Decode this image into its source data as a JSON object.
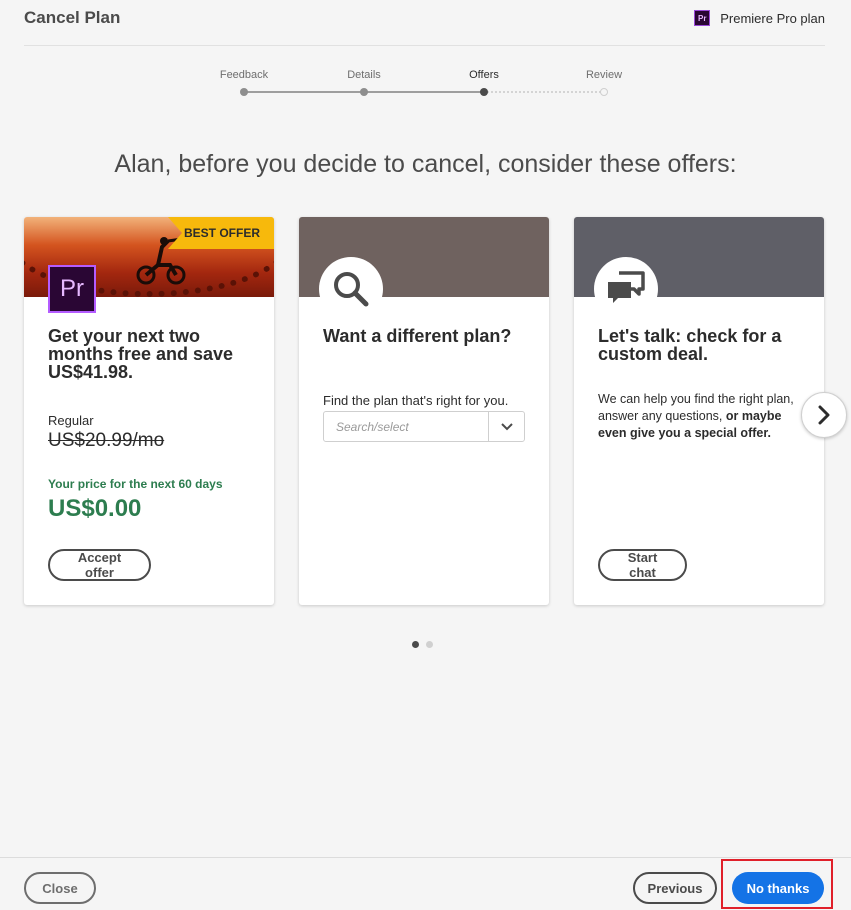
{
  "header": {
    "title": "Cancel Plan",
    "plan_badge": "Pr",
    "plan_name": "Premiere Pro plan"
  },
  "stepper": {
    "steps": [
      {
        "label": "Feedback",
        "state": "done"
      },
      {
        "label": "Details",
        "state": "done"
      },
      {
        "label": "Offers",
        "state": "current"
      },
      {
        "label": "Review",
        "state": "future"
      }
    ]
  },
  "headline": "Alan, before you decide to cancel, consider these offers:",
  "cards": {
    "offer": {
      "ribbon": "BEST OFFER",
      "logo_text": "Pr",
      "title": "Get your next two months free and save US$41.98.",
      "regular_label": "Regular",
      "regular_price": "US$20.99/mo",
      "promo_label": "Your price for the next 60 days",
      "promo_price": "US$0.00",
      "button": "Accept offer"
    },
    "plan": {
      "title": "Want a different plan?",
      "field_label": "Find the plan that's right for you.",
      "placeholder": "Search/select",
      "icon": "search-icon"
    },
    "talk": {
      "title": "Let's talk: check for a custom deal.",
      "text_plain": "We can help you find the right plan, answer any questions,",
      "text_bold": "or maybe even give you a special offer.",
      "button": "Start chat",
      "icon": "chat-bubbles-icon"
    }
  },
  "carousel": {
    "page": 1,
    "pages": 2
  },
  "footer": {
    "close": "Close",
    "previous": "Previous",
    "primary": "No thanks"
  },
  "colors": {
    "primary": "#1473e6",
    "promo_green": "#2d7d4f",
    "ribbon_yellow": "#f7b90c",
    "highlight_red": "#e0202a"
  }
}
